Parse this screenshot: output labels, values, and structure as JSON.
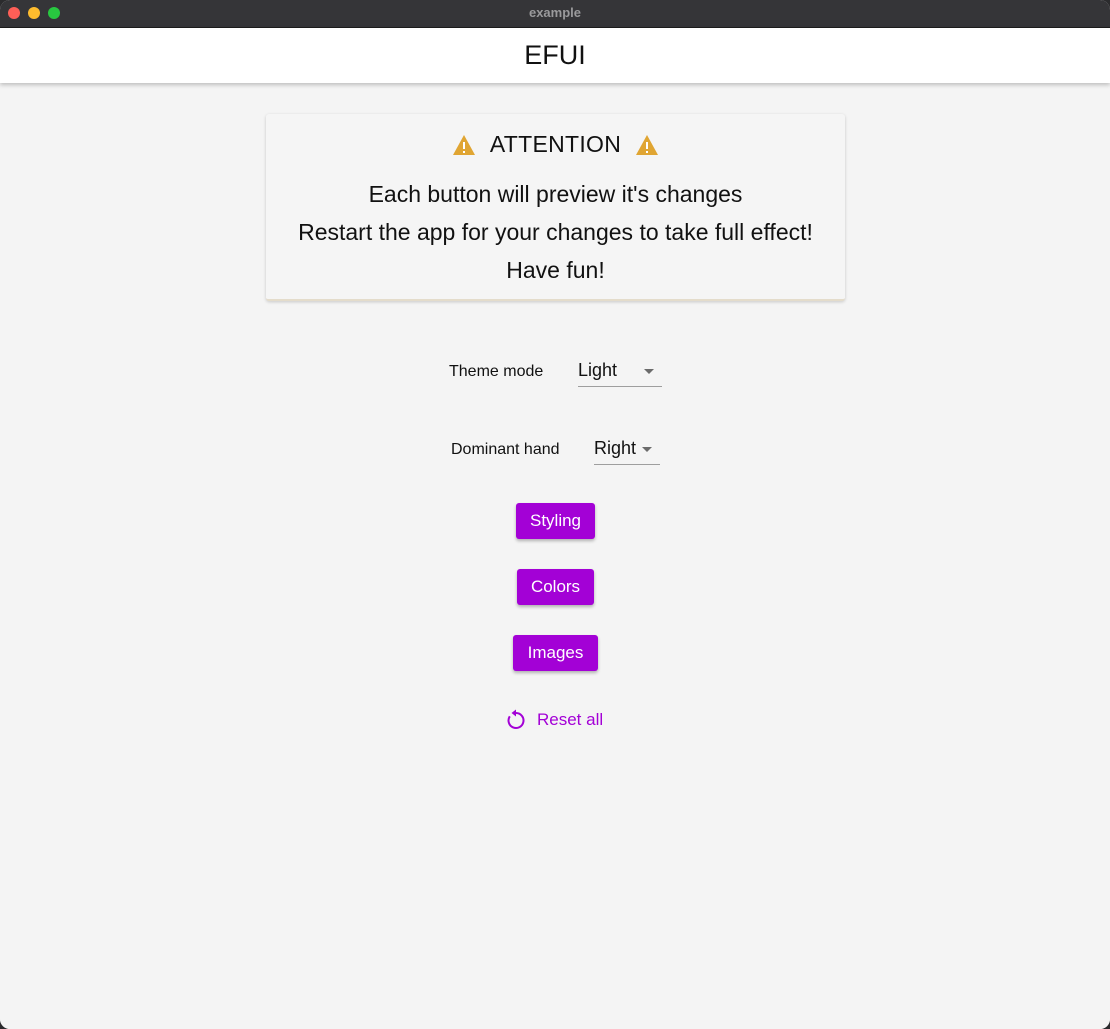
{
  "window": {
    "title": "example"
  },
  "appbar": {
    "title": "EFUI"
  },
  "attention": {
    "title": "ATTENTION",
    "icon": "warning-icon",
    "icon_color": "#e0a532",
    "lines": [
      "Each button will preview it's changes",
      "Restart the app for your changes to take full effect!",
      "Have fun!"
    ]
  },
  "settings": {
    "theme_mode": {
      "label": "Theme mode",
      "value": "Light"
    },
    "dominant_hand": {
      "label": "Dominant hand",
      "value": "Right"
    }
  },
  "buttons": {
    "styling": "Styling",
    "colors": "Colors",
    "images": "Images",
    "reset_all": "Reset all",
    "reset_icon": "refresh-icon"
  },
  "colors": {
    "accent": "#a301d6",
    "warning": "#e0a532",
    "background": "#f4f4f4",
    "appbar": "#ffffff"
  }
}
